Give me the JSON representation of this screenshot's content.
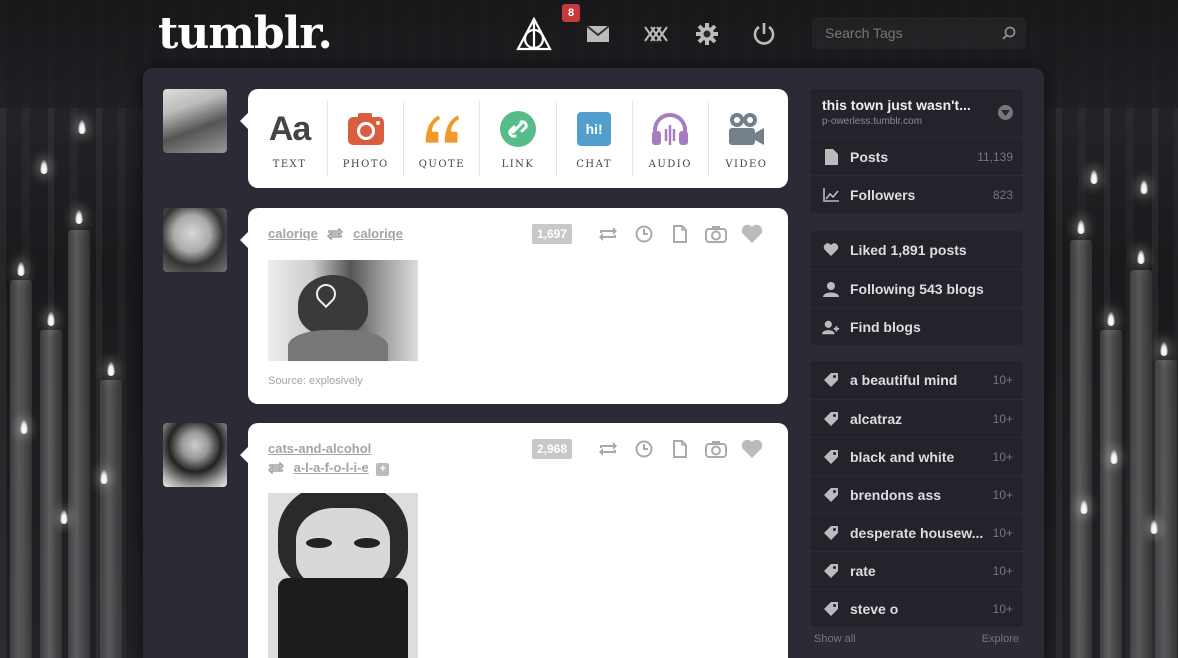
{
  "header": {
    "logo": "tumblr.",
    "notifications_count": "8",
    "search_placeholder": "Search Tags"
  },
  "composer": {
    "types": [
      {
        "label": "TEXT",
        "icon": "text-icon",
        "glyph": "Aa",
        "color": "#444444"
      },
      {
        "label": "PHOTO",
        "icon": "camera-icon",
        "color": "#d95e40"
      },
      {
        "label": "QUOTE",
        "icon": "quote-icon",
        "color": "#f2992e"
      },
      {
        "label": "LINK",
        "icon": "link-icon",
        "color": "#56bc8a"
      },
      {
        "label": "CHAT",
        "icon": "chat-icon",
        "glyph": "hi!",
        "color": "#529ecc"
      },
      {
        "label": "AUDIO",
        "icon": "headphones-icon",
        "color": "#a77dc2"
      },
      {
        "label": "VIDEO",
        "icon": "video-camera-icon",
        "color": "#748089"
      }
    ]
  },
  "posts": [
    {
      "author": "caloriqe",
      "reblogged_from": "caloriqe",
      "notes": "1,697",
      "source": "Source: explosively"
    },
    {
      "author": "cats-and-alcohol",
      "reblogged_from": "a-l-a-f-o-l-i-e",
      "notes": "2,968"
    }
  ],
  "sidebar": {
    "blog": {
      "title": "this town just wasn't...",
      "url": "p-owerless.tumblr.com"
    },
    "blog_stats": [
      {
        "label": "Posts",
        "count": "11,139",
        "icon": "document-icon"
      },
      {
        "label": "Followers",
        "count": "823",
        "icon": "chart-icon"
      }
    ],
    "account": [
      {
        "label": "Liked 1,891 posts",
        "icon": "heart-icon"
      },
      {
        "label": "Following 543 blogs",
        "icon": "user-icon"
      },
      {
        "label": "Find blogs",
        "icon": "add-user-icon"
      }
    ],
    "tags": [
      {
        "label": "a beautiful mind",
        "count": "10+"
      },
      {
        "label": "alcatraz",
        "count": "10+"
      },
      {
        "label": "black and white",
        "count": "10+"
      },
      {
        "label": "brendons ass",
        "count": "10+"
      },
      {
        "label": "desperate housew...",
        "count": "10+"
      },
      {
        "label": "rate",
        "count": "10+"
      },
      {
        "label": "steve o",
        "count": "10+"
      }
    ],
    "footer": {
      "show_all": "Show all",
      "explore": "Explore"
    }
  }
}
